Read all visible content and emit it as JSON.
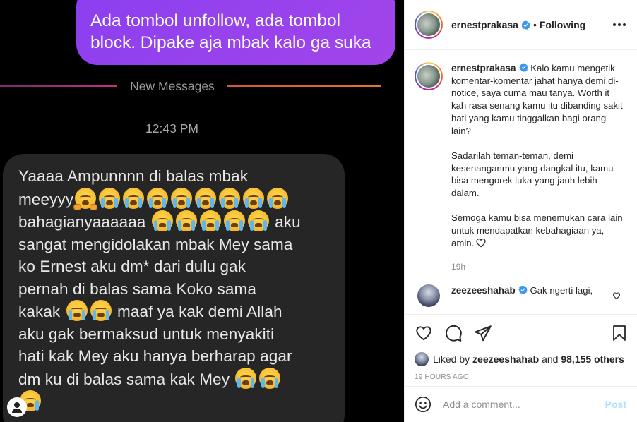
{
  "chat_image": {
    "outgoing_message": "Ada tombol unfollow, ada tombol block. Dipake aja mbak kalo ga suka",
    "outgoing_line1": "Ada tombol unfollow, ada tombol",
    "outgoing_line2": "block. Dipake aja mbak kalo ga suka",
    "divider_label": "New Messages",
    "timestamp": "12:43 PM",
    "incoming_lines": [
      "Yaaaa Ampunnnn di balas mbak",
      "meeyyy",
      "bahagianyaaaaaa",
      "aku",
      "sangat mengidolakan mbak Mey sama",
      "ko Ernest aku dm* dari dulu gak",
      "pernah di balas sama Koko sama",
      "kakak",
      "maaf ya kak demi Allah",
      "aku gak bermaksud untuk menyakiti",
      "hati kak Mey aku hanya berharap agar",
      "dm ku di balas sama kak Mey"
    ]
  },
  "header": {
    "username": "ernestprakasa",
    "separator": "•",
    "follow_status": "Following"
  },
  "caption": {
    "username": "ernestprakasa",
    "paragraph1": "Kalo kamu mengetik komentar-komentar jahat hanya demi di-notice, saya cuma mau tanya. Worth it kah rasa senang kamu itu dibanding sakit hati yang kamu tinggalkan bagi orang lain?",
    "paragraph2": "Sadarilah teman-teman, demi kesenanganmu yang dangkal itu, kamu bisa mengorek luka yang jauh lebih dalam.",
    "paragraph3": "Semoga kamu bisa menemukan cara lain untuk mendapatkan kebahagiaan ya, amin.",
    "age": "19h"
  },
  "comment": {
    "username": "zeezeeshahab",
    "text": "Gak ngerti lagi,"
  },
  "likes": {
    "prefix": "Liked by",
    "user": "zeezeeshahab",
    "middle": "and",
    "others": "98,155 others"
  },
  "timestamp": "19 HOURS AGO",
  "add_comment": {
    "placeholder": "Add a comment...",
    "post_label": "Post"
  },
  "colors": {
    "outgoing_bubble": "#a245ea",
    "incoming_bubble": "#262626",
    "verified": "#3897f0",
    "post_button_disabled": "#b2dffc"
  },
  "icons": [
    "verified-badge-icon",
    "more-options-icon",
    "heart-icon",
    "comment-icon",
    "share-icon",
    "bookmark-icon",
    "emoji-icon",
    "crying-face-emoji",
    "hugging-face-emoji",
    "user-icon"
  ]
}
